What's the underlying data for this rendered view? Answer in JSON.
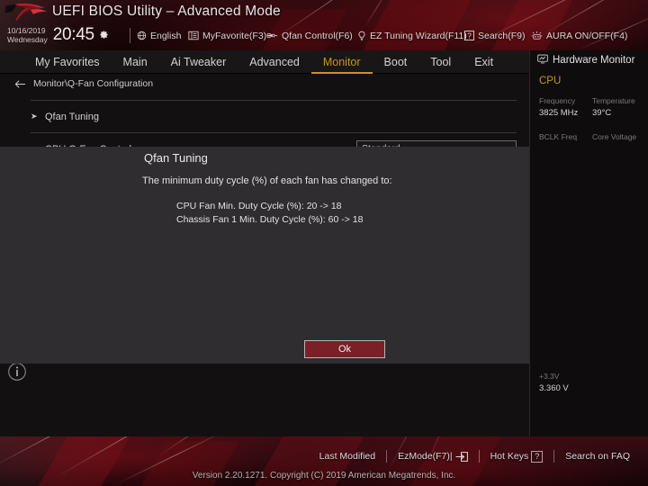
{
  "header": {
    "logo": "rog-logo",
    "title": "UEFI BIOS Utility – Advanced Mode",
    "date": "10/16/2019",
    "weekday": "Wednesday",
    "time": "20:45",
    "gear_icon": "gear-icon",
    "items": [
      {
        "label": "English",
        "icon": "globe-icon"
      },
      {
        "label": "MyFavorite(F3)",
        "icon": "list-icon"
      },
      {
        "label": "Qfan Control(F6)",
        "icon": "fan-icon"
      },
      {
        "label": "EZ Tuning Wizard(F11)",
        "icon": "lightbulb-icon"
      },
      {
        "label": "Search(F9)",
        "icon": "question-box-icon"
      },
      {
        "label": "AURA ON/OFF(F4)",
        "icon": "aura-icon"
      }
    ]
  },
  "nav": {
    "tabs": [
      {
        "label": "My Favorites",
        "active": false
      },
      {
        "label": "Main",
        "active": false
      },
      {
        "label": "Ai Tweaker",
        "active": false
      },
      {
        "label": "Advanced",
        "active": false
      },
      {
        "label": "Monitor",
        "active": true
      },
      {
        "label": "Boot",
        "active": false
      },
      {
        "label": "Tool",
        "active": false
      },
      {
        "label": "Exit",
        "active": false
      }
    ],
    "active_color": "#c6951f"
  },
  "main": {
    "breadcrumb": "Monitor\\Q-Fan Configuration",
    "back_icon": "back-arrow-icon",
    "rows": [
      {
        "label": "Qfan Tuning",
        "caret": "➤",
        "value": ""
      },
      {
        "label": "CPU Q-Fan Control",
        "caret": "",
        "value": "Standard"
      }
    ],
    "info_icon": "info-icon"
  },
  "modal": {
    "title": "Qfan Tuning",
    "message": "The minimum duty cycle (%) of each fan has changed to:",
    "details": [
      "CPU Fan Min. Duty Cycle (%): 20 -> 18",
      "Chassis Fan 1 Min. Duty Cycle (%): 60 -> 18"
    ],
    "ok_label": "Ok",
    "ok_color": "#7a2026"
  },
  "sidebar": {
    "title": "Hardware Monitor",
    "title_icon": "monitor-icon",
    "sections": [
      {
        "name": "CPU",
        "rows": [
          [
            {
              "label": "Frequency",
              "value": "3825 MHz"
            },
            {
              "label": "Temperature",
              "value": "39°C"
            }
          ],
          [
            {
              "label": "BCLK Freq",
              "value": ""
            },
            {
              "label": "Core Voltage",
              "value": ""
            }
          ]
        ]
      }
    ],
    "voltage": {
      "label": "+3.3V",
      "value": "3.360 V"
    }
  },
  "footer": {
    "links": [
      {
        "label": "Last Modified",
        "icon": ""
      },
      {
        "label": "EzMode(F7)|",
        "icon": "arrow-exit-icon"
      },
      {
        "label": "Hot Keys",
        "icon": "question-key-icon"
      },
      {
        "label": "Search on FAQ",
        "icon": ""
      }
    ],
    "version": "Version 2.20.1271. Copyright (C) 2019 American Megatrends, Inc."
  }
}
